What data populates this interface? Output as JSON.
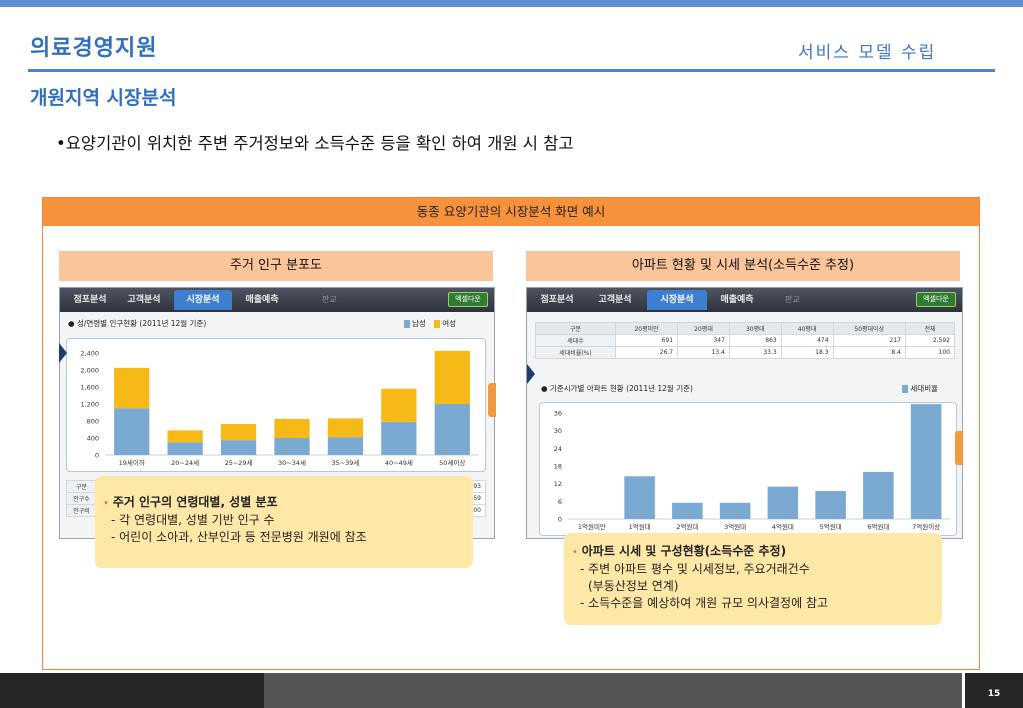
{
  "header": {
    "brand": "의료경영지원",
    "model": "서비스 모델 수립",
    "section_title": "개원지역 시장분석",
    "bullet": "•요양기관이 위치한 주변 주거정보와 소득수준 등을 확인 하여 개원 시 참고"
  },
  "frame": {
    "title": "동종 요양기관의 시장분석 화면 예시"
  },
  "left_panel": {
    "label": "주거 인구 분포도",
    "tabs": [
      "점포분석",
      "고객분석",
      "시장분석",
      "매출예측"
    ],
    "active_tab": 2,
    "excel": "엑셀다운",
    "map_text": "판교",
    "caption": "성/연령별 인구현황 (2011년 12월 기준)",
    "legend": [
      {
        "name": "남성",
        "color": "#7aa9d2"
      },
      {
        "name": "여성",
        "color": "#f7b916"
      }
    ],
    "table_row_labels": [
      "구분",
      "인구수",
      "인구비"
    ],
    "table_partial_values": [
      "493",
      "659",
      "100"
    ]
  },
  "right_panel": {
    "label": "아파트 현황 및 시세 분석(소득수준 추정)",
    "tabs": [
      "점포분석",
      "고객분석",
      "시장분석",
      "매출예측"
    ],
    "active_tab": 2,
    "excel": "엑셀다운",
    "map_text": "판교",
    "table": {
      "headers": [
        "구분",
        "20평미만",
        "20평대",
        "30평대",
        "40평대",
        "50평대이상",
        "전체"
      ],
      "rows": [
        [
          "세대수",
          "691",
          "347",
          "863",
          "474",
          "217",
          "2,592"
        ],
        [
          "세대비율(%)",
          "26.7",
          "13.4",
          "33.3",
          "18.3",
          "8.4",
          "100"
        ]
      ]
    },
    "caption": "기준시가별 아파트 현황 (2011년 12월 기준)",
    "legend": [
      {
        "name": "세대비율",
        "color": "#7aa9d2"
      }
    ]
  },
  "chart_data": [
    {
      "type": "bar",
      "stacked": true,
      "categories": [
        "19세이하",
        "20~24세",
        "25~29세",
        "30~34세",
        "35~39세",
        "40~49세",
        "50세이상"
      ],
      "series": [
        {
          "name": "남성",
          "color": "#7aa9d2",
          "values": [
            1100,
            300,
            350,
            400,
            420,
            780,
            1200
          ]
        },
        {
          "name": "여성",
          "color": "#f7b916",
          "values": [
            950,
            280,
            380,
            450,
            440,
            780,
            1250
          ]
        }
      ],
      "ylim": [
        0,
        2400
      ],
      "yticks": [
        "0",
        "400",
        "800",
        "1,200",
        "1,600",
        "2,000",
        "2,400"
      ],
      "grid": false,
      "legend": "top-right"
    },
    {
      "type": "bar",
      "categories": [
        "1억원미만",
        "1억원대",
        "2억원대",
        "3억원대",
        "4억원대",
        "5억원대",
        "6억원대",
        "7억원이상"
      ],
      "series": [
        {
          "name": "세대비율",
          "color": "#7aa9d2",
          "values": [
            0,
            14.5,
            5.5,
            5.5,
            11,
            9.5,
            16,
            39
          ]
        }
      ],
      "ylim": [
        0,
        36
      ],
      "yticks": [
        "0",
        "6",
        "12",
        "18",
        "24",
        "30",
        "36"
      ],
      "grid": false,
      "legend": "top-right"
    }
  ],
  "notes": {
    "left": {
      "title": "주거 인구의 연령대별, 성별 분포",
      "items": [
        "- 각 연령대별, 성별 기반 인구 수",
        "- 어린이 소아과, 산부인과 등 전문병원 개원에 참조"
      ]
    },
    "right": {
      "title": "아파트 시세 및 구성현황(소득수준 추정)",
      "items": [
        "- 주변 아파트 평수 및 시세정보, 주요거래건수",
        "(부동산정보 연계)",
        "- 소득수준을 예상하여 개원 규모 의사결정에 참고"
      ]
    }
  },
  "footer": {
    "page_number": "15"
  }
}
